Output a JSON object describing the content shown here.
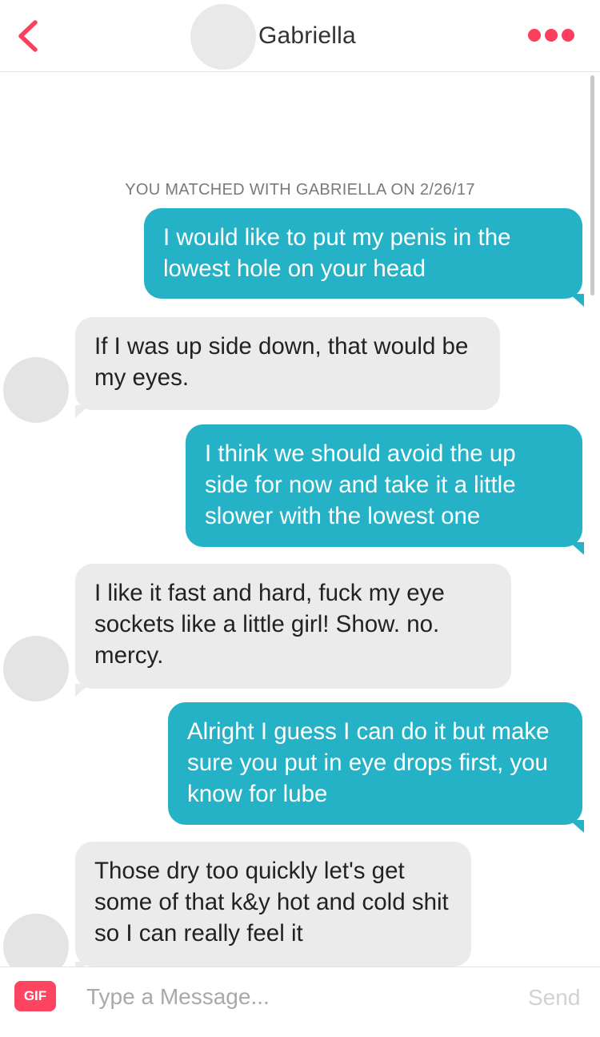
{
  "header": {
    "title": "Gabriella",
    "back_icon": "chevron-left-icon",
    "more_icon": "more-dots-icon",
    "accent_color": "#fd3f5e"
  },
  "chat": {
    "match_note": "YOU MATCHED WITH GABRIELLA ON 2/26/17",
    "colors": {
      "me": "#26b2c6",
      "them": "#ebebeb"
    },
    "messages": [
      {
        "from": "me",
        "text": "I would like to put my penis in the lowest hole on your head"
      },
      {
        "from": "them",
        "text": "If I was up side down, that would be my eyes."
      },
      {
        "from": "me",
        "text": "I think we should avoid the up side for now and take it a little slower with the lowest one"
      },
      {
        "from": "them",
        "text": "I like it fast and hard, fuck my eye sockets like a little girl! Show. no. mercy."
      },
      {
        "from": "me",
        "text": "Alright I guess I can do it but make sure you put in eye drops first, you know for lube"
      },
      {
        "from": "them",
        "text": "Those dry too quickly let's get some of that k&y hot and cold shit so I can really feel it"
      }
    ]
  },
  "composer": {
    "gif_label": "GIF",
    "placeholder": "Type a Message...",
    "value": "",
    "send_label": "Send"
  }
}
